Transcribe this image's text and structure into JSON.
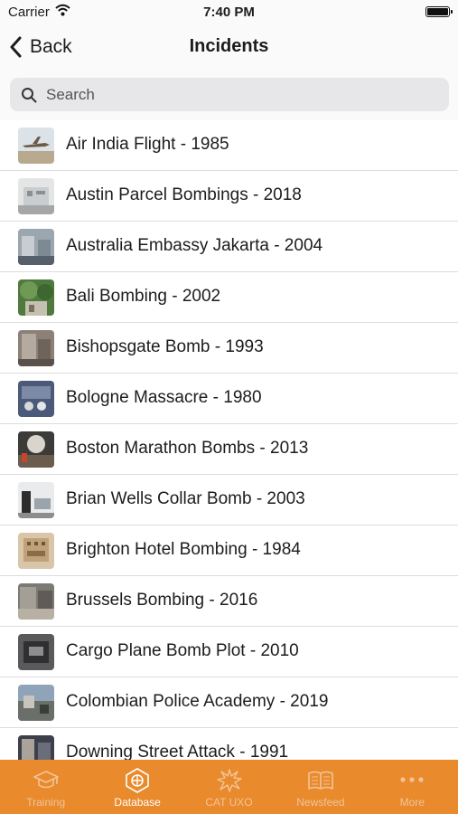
{
  "status_bar": {
    "carrier": "Carrier",
    "time": "7:40 PM"
  },
  "nav": {
    "back_label": "Back",
    "title": "Incidents"
  },
  "search": {
    "placeholder": "Search"
  },
  "incidents": [
    {
      "title": "Air India Flight - 1985"
    },
    {
      "title": "Austin Parcel Bombings - 2018"
    },
    {
      "title": "Australia Embassy Jakarta - 2004"
    },
    {
      "title": "Bali Bombing - 2002"
    },
    {
      "title": "Bishopsgate Bomb - 1993"
    },
    {
      "title": "Bologne Massacre - 1980"
    },
    {
      "title": "Boston Marathon Bombs - 2013"
    },
    {
      "title": "Brian Wells Collar Bomb - 2003"
    },
    {
      "title": "Brighton Hotel Bombing - 1984"
    },
    {
      "title": "Brussels Bombing - 2016"
    },
    {
      "title": "Cargo Plane Bomb Plot - 2010"
    },
    {
      "title": "Colombian Police Academy - 2019"
    },
    {
      "title": "Downing Street Attack - 1991"
    }
  ],
  "tabs": [
    {
      "label": "Training",
      "icon": "graduation-cap-icon",
      "active": false
    },
    {
      "label": "Database",
      "icon": "database-icon",
      "active": true
    },
    {
      "label": "CAT UXO",
      "icon": "explosion-icon",
      "active": false
    },
    {
      "label": "Newsfeed",
      "icon": "book-icon",
      "active": false
    },
    {
      "label": "More",
      "icon": "more-dots-icon",
      "active": false
    }
  ],
  "colors": {
    "accent": "#E98A2C",
    "tab_active": "#FFFFFF",
    "tab_inactive": "#F3C49A"
  }
}
